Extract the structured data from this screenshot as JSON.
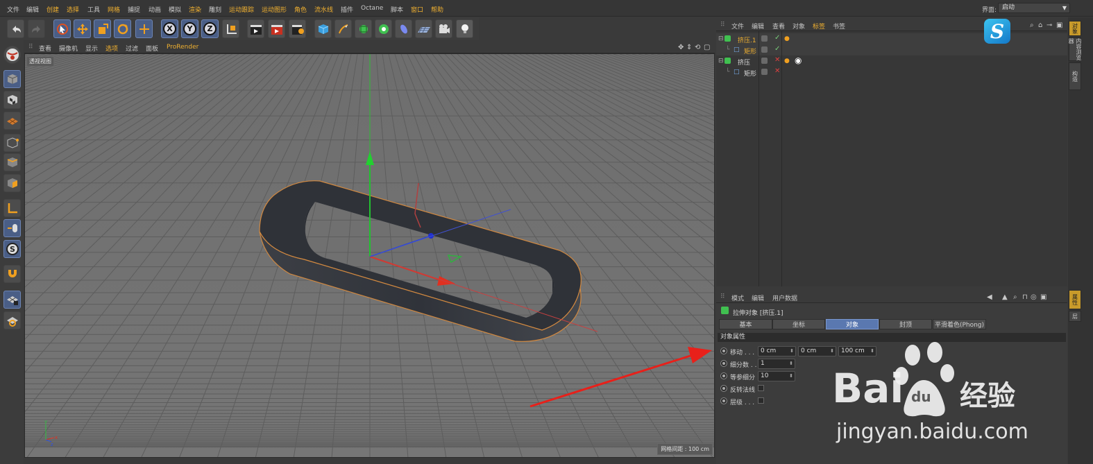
{
  "menubar": {
    "items": [
      "文件",
      "编辑",
      "创建",
      "选择",
      "工具",
      "网格",
      "捕捉",
      "动画",
      "模拟",
      "渲染",
      "雕刻",
      "运动跟踪",
      "运动图形",
      "角色",
      "流水线",
      "插件",
      "Octane",
      "脚本",
      "窗口",
      "帮助"
    ],
    "interface_label": "界面:",
    "interface_value": "启动"
  },
  "toolbar": {
    "undo_icon": "undo-icon",
    "axis_x": "X",
    "axis_y": "Y",
    "axis_z": "Z"
  },
  "viewport_menu": {
    "items": [
      "查看",
      "摄像机",
      "显示",
      "选项",
      "过滤",
      "面板",
      "ProRender"
    ],
    "view_label": "透视视图",
    "grid_readout": "网格间距 : 100 cm"
  },
  "object_manager": {
    "menu": [
      "文件",
      "编辑",
      "查看",
      "对象",
      "标签",
      "书签"
    ],
    "objects": [
      {
        "name": "挤压.1",
        "level": 0,
        "type": "extrude"
      },
      {
        "name": "矩形",
        "level": 1,
        "type": "rectangle"
      },
      {
        "name": "挤压",
        "level": 0,
        "type": "extrude"
      },
      {
        "name": "矩形",
        "level": 1,
        "type": "rectangle"
      }
    ]
  },
  "right_tabs": [
    "对象",
    "内容浏览器",
    "构造",
    "属性",
    "层"
  ],
  "attributes": {
    "menu": [
      "模式",
      "编辑",
      "用户数据"
    ],
    "title": "拉伸对象 [挤压.1]",
    "tabs": [
      "基本",
      "坐标",
      "对象",
      "封顶",
      "平滑着色(Phong)"
    ],
    "active_tab": "对象",
    "section": "对象属性",
    "move_label": "移动 . . .",
    "move_x": "0 cm",
    "move_y": "0 cm",
    "move_z": "100 cm",
    "subdivision_label": "细分数 . .",
    "subdivision_value": "1",
    "iso_label": "等参细分",
    "iso_value": "10",
    "flip_normals_label": "反转法线",
    "hierarchical_label": "层级 . . ."
  },
  "watermark": {
    "brand": "Bai",
    "brand2": "du",
    "cn": "经验",
    "url": "jingyan.baidu.com"
  },
  "colors": {
    "accent_orange": "#f0b030",
    "selected_blue": "#4a5e86",
    "viewport_bg": "#707070",
    "arrow_red": "#e8201a"
  }
}
